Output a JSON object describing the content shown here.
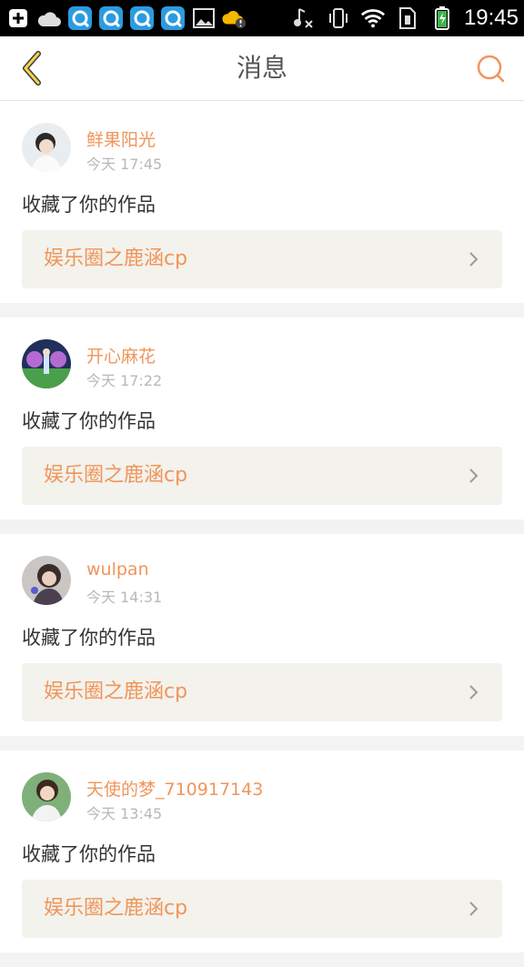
{
  "status_bar": {
    "time": "19:45",
    "icons": [
      "add-box-icon",
      "cloud-icon",
      "app-q-icon",
      "app-q-icon",
      "app-q-icon",
      "app-q-icon",
      "image-icon",
      "weather-alert-icon",
      "music-mute-icon",
      "vibrate-icon",
      "wifi-icon",
      "sim-icon",
      "battery-charging-icon"
    ]
  },
  "header": {
    "title": "消息",
    "back_icon": "chevron-left-icon",
    "search_icon": "search-icon",
    "accent": "#f0955a"
  },
  "messages": [
    {
      "user": "鲜果阳光",
      "time": "今天 17:45",
      "action": "收藏了你的作品",
      "work": "娱乐圈之鹿涵cp"
    },
    {
      "user": "开心麻花",
      "time": "今天 17:22",
      "action": "收藏了你的作品",
      "work": "娱乐圈之鹿涵cp"
    },
    {
      "user": "wulpan",
      "time": "今天 14:31",
      "action": "收藏了你的作品",
      "work": "娱乐圈之鹿涵cp"
    },
    {
      "user": "天使的梦_710917143",
      "time": "今天 13:45",
      "action": "收藏了你的作品",
      "work": "娱乐圈之鹿涵cp"
    }
  ]
}
